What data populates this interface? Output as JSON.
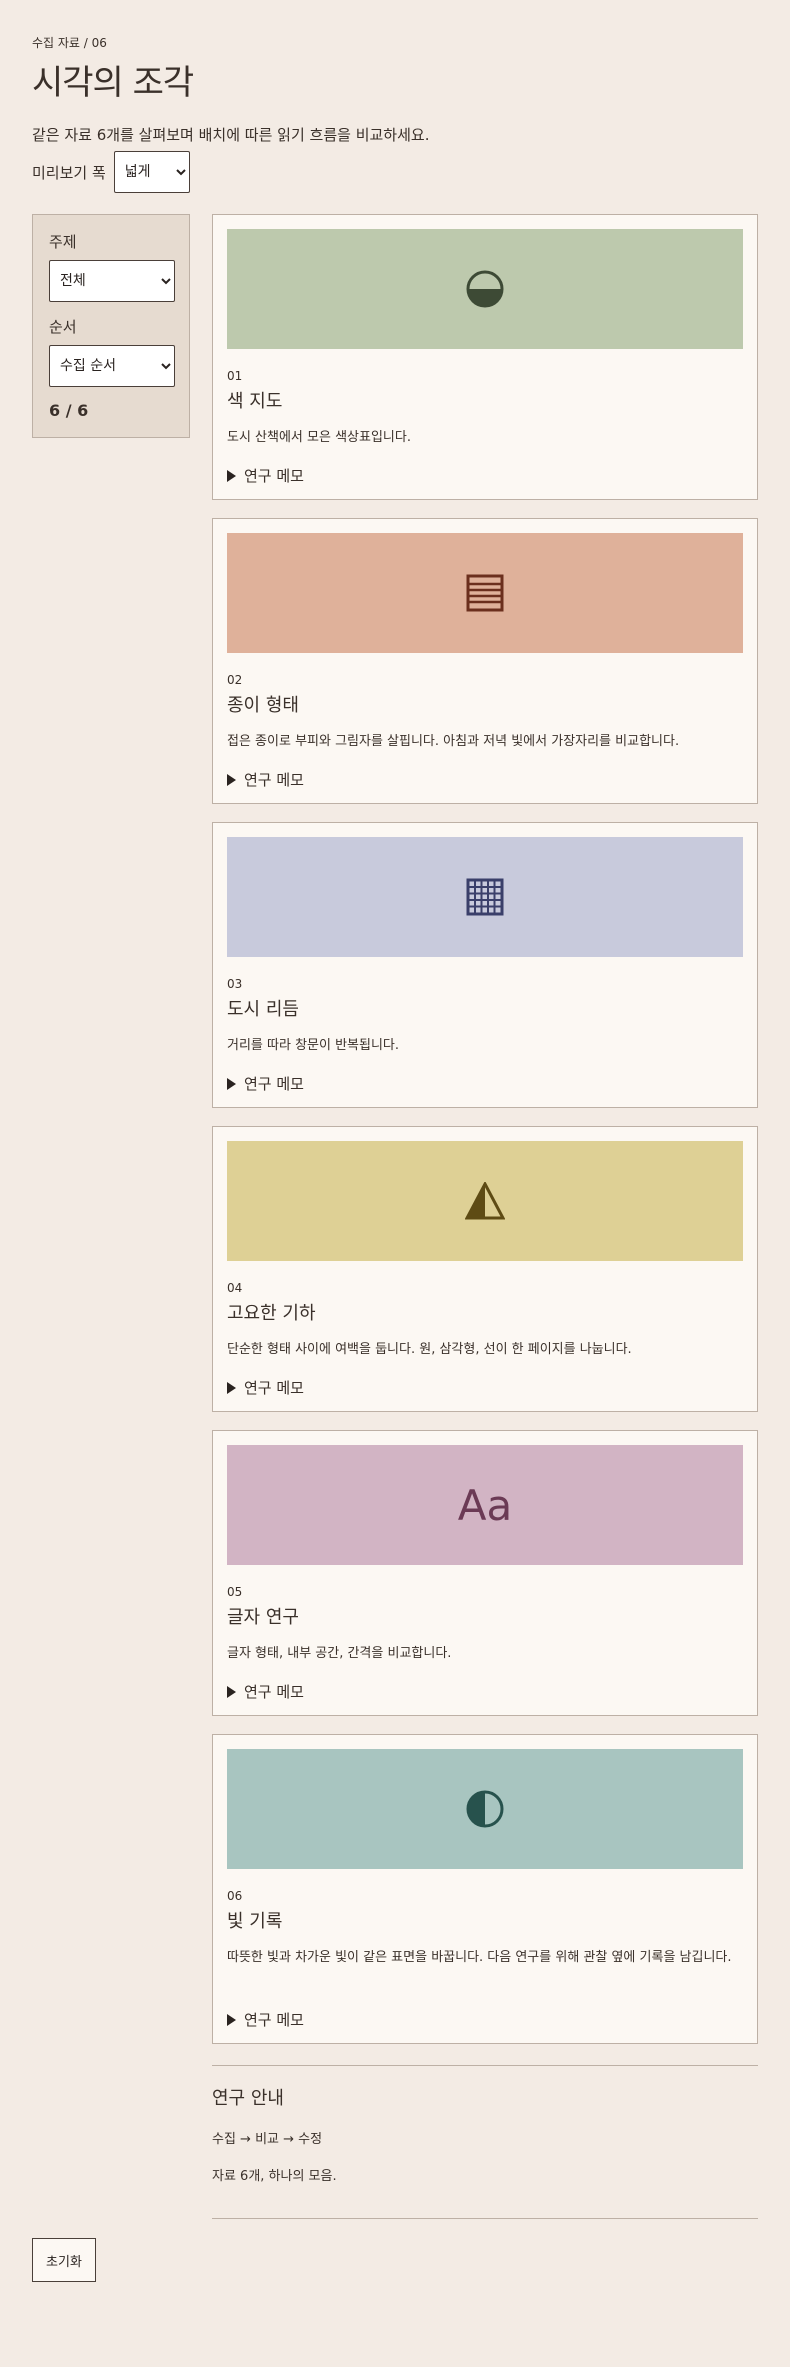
{
  "header": {
    "breadcrumb": "수집 자료 / 06",
    "title": "시각의 조각",
    "intro": "같은 자료 6개를 살펴보며 배치에 따른 읽기 흐름을 비교하세요."
  },
  "preview_width": {
    "label": "미리보기 폭",
    "value": "넓게"
  },
  "sidebar": {
    "topic_label": "주제",
    "topic_value": "전체",
    "order_label": "순서",
    "order_value": "수집 순서",
    "count": "6 / 6"
  },
  "cards": [
    {
      "num": "01",
      "title": "색 지도",
      "desc": "도시 산책에서 모은 색상표입니다.",
      "memo": "연구 메모",
      "icon": "half-circle-icon",
      "color": "#bdc9ad"
    },
    {
      "num": "02",
      "title": "종이 형태",
      "desc": "접은 종이로 부피와 그림자를 살핍니다. 아침과 저녁 빛에서 가장자리를 비교합니다.",
      "memo": "연구 메모",
      "icon": "lines-icon",
      "color": "#dfb19a"
    },
    {
      "num": "03",
      "title": "도시 리듬",
      "desc": "거리를 따라 창문이 반복됩니다.",
      "memo": "연구 메모",
      "icon": "grid-icon",
      "color": "#c8cadc"
    },
    {
      "num": "04",
      "title": "고요한 기하",
      "desc": "단순한 형태 사이에 여백을 둡니다. 원, 삼각형, 선이 한 페이지를 나눕니다.",
      "memo": "연구 메모",
      "icon": "triangle-icon",
      "color": "#ded095"
    },
    {
      "num": "05",
      "title": "글자 연구",
      "desc": "글자 형태, 내부 공간, 간격을 비교합니다.",
      "memo": "연구 메모",
      "icon": "type-icon",
      "glyph": "Aa",
      "color": "#d2b4c4"
    },
    {
      "num": "06",
      "title": "빛 기록",
      "desc": "따뜻한 빛과 차가운 빛이 같은 표면을 바꿉니다. 다음 연구를 위해 관찰 옆에 기록을 남깁니다.",
      "memo": "연구 메모",
      "icon": "contrast-icon",
      "color": "#a8c5c0"
    }
  ],
  "guide": {
    "title": "연구 안내",
    "flow": "수집 → 비교 → 수정",
    "summary": "자료 6개, 하나의 모음."
  },
  "reset_label": "초기화"
}
